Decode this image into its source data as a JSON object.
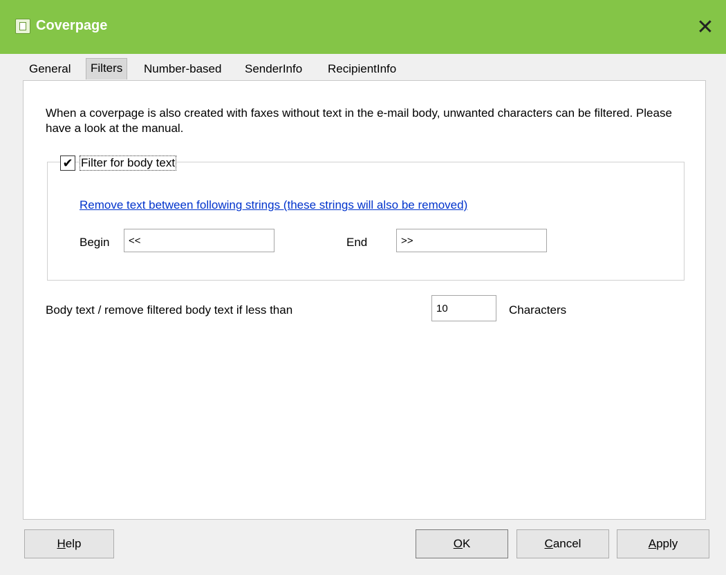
{
  "window": {
    "title": "Coverpage",
    "close_glyph": "✕"
  },
  "tabs": [
    {
      "label": "General"
    },
    {
      "label": "Filters",
      "active": true
    },
    {
      "label": "Number-based"
    },
    {
      "label": "SenderInfo"
    },
    {
      "label": "RecipientInfo"
    }
  ],
  "filters": {
    "description": "When a coverpage is also created with faxes without text in the e-mail body, unwanted characters can be filtered. Please have a look at the manual.",
    "filter_body": {
      "checked": true,
      "check_glyph": "✔",
      "label": "Filter for body text",
      "link_text": "Remove text between following strings (these strings will also be removed)",
      "begin_label": "Begin",
      "begin_value": "<<",
      "end_label": "End",
      "end_value": ">>"
    },
    "min_body": {
      "label": "Body text / remove filtered body text if less than",
      "value": "10",
      "unit_label": "Characters"
    }
  },
  "buttons": {
    "help": {
      "accel": "H",
      "rest": "elp"
    },
    "ok": {
      "accel": "O",
      "rest": "K"
    },
    "cancel": {
      "accel": "C",
      "rest": "ancel"
    },
    "apply": {
      "accel": "A",
      "rest": "pply"
    }
  }
}
